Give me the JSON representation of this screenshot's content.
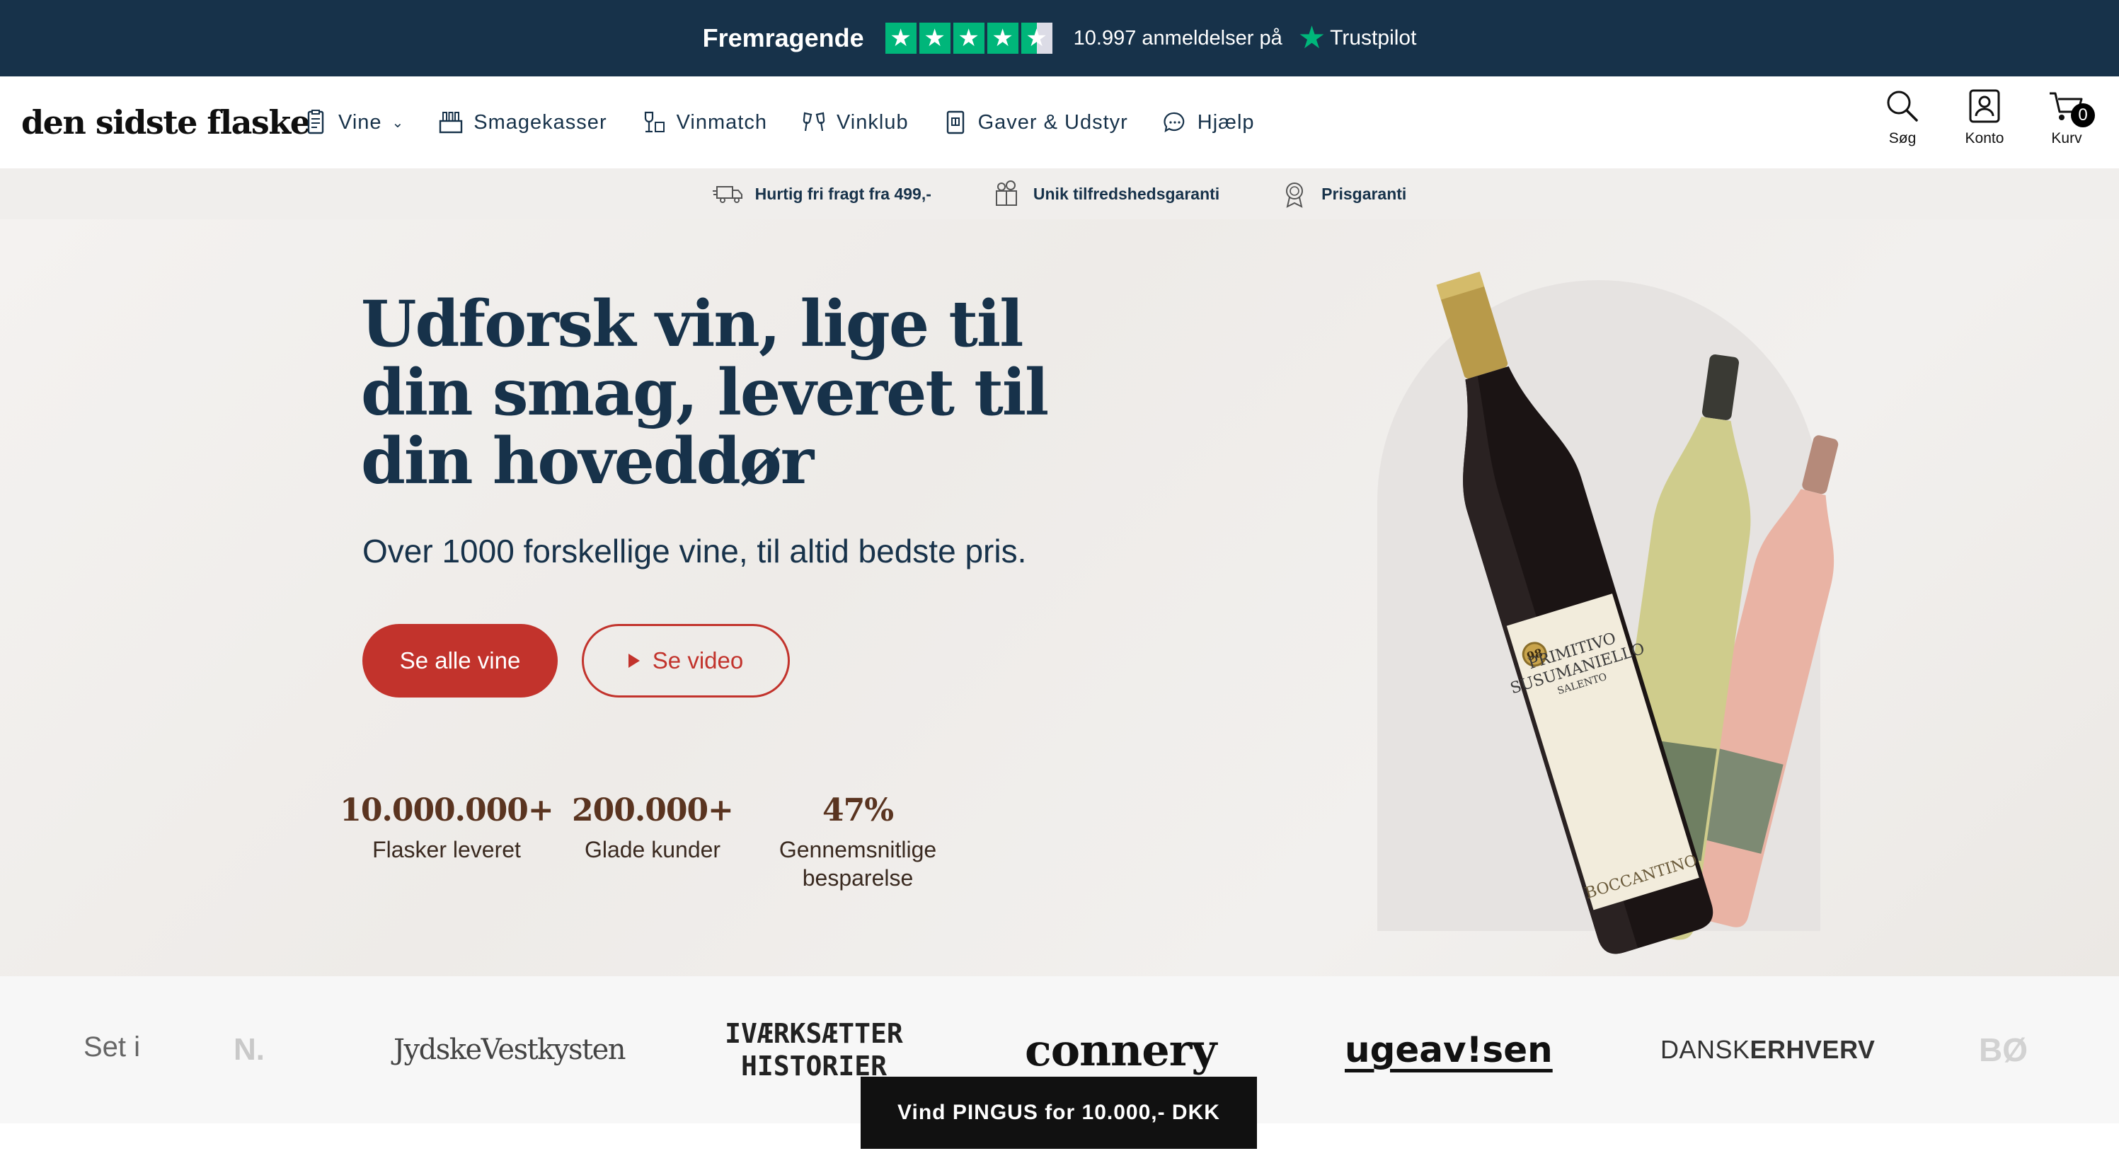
{
  "trustpilot": {
    "rating_label": "Fremragende",
    "stars": 4.5,
    "reviews_text": "10.997 anmeldelser på",
    "brand": "Trustpilot"
  },
  "header": {
    "logo": "den sidste flaske",
    "nav": [
      {
        "label": "Vine",
        "icon": "wine-list-icon",
        "has_dropdown": true
      },
      {
        "label": "Smagekasser",
        "icon": "wine-box-icon"
      },
      {
        "label": "Vinmatch",
        "icon": "wine-match-icon"
      },
      {
        "label": "Vinklub",
        "icon": "cheers-glasses-icon"
      },
      {
        "label": "Gaver & Udstyr",
        "icon": "gift-card-icon"
      },
      {
        "label": "Hjælp",
        "icon": "chat-bubble-icon"
      }
    ],
    "utils": {
      "search": "Søg",
      "account": "Konto",
      "cart": "Kurv",
      "cart_count": "0"
    }
  },
  "usp": [
    {
      "label": "Hurtig fri fragt fra 499,-",
      "icon": "delivery-truck-icon"
    },
    {
      "label": "Unik tilfredshedsgaranti",
      "icon": "satisfaction-badge-icon"
    },
    {
      "label": "Prisgaranti",
      "icon": "price-medal-icon"
    }
  ],
  "hero": {
    "title": "Udforsk vin, lige til din smag, leveret til din hoveddør",
    "subtitle": "Over 1000 forskellige vine, til altid bedste pris.",
    "primary_button": "Se alle vine",
    "secondary_button": "Se video",
    "stats": [
      {
        "value": "10.000.000+",
        "label": "Flasker leveret"
      },
      {
        "value": "200.000+",
        "label": "Glade kunder"
      },
      {
        "value": "47%",
        "label": "Gennemsnitlige besparelse"
      }
    ],
    "bottle_label": {
      "line1": "PRIMITIVO",
      "line2": "SUSUMANIELLO",
      "line3": "SALENTO",
      "brand": "BOCCANTINO",
      "score": "98"
    }
  },
  "press": {
    "label": "Set i",
    "logos": {
      "n": "N.",
      "jydske": "JydskeVestkysten",
      "ivaerksaetter_1": "IVÆRKSÆTTER",
      "ivaerksaetter_2": "HISTORIER",
      "connery": "connery",
      "ugeavisen": "ugeav!sen",
      "dansk": "DANSK",
      "erhverv": "ERHVERV",
      "bo": "BØ"
    }
  },
  "contest_button": "Vind PINGUS for 10.000,- DKK",
  "colors": {
    "navy": "#17324a",
    "accent_red": "#c2332c",
    "trustpilot_green": "#00b67a",
    "stat_brown": "#5a3420"
  }
}
